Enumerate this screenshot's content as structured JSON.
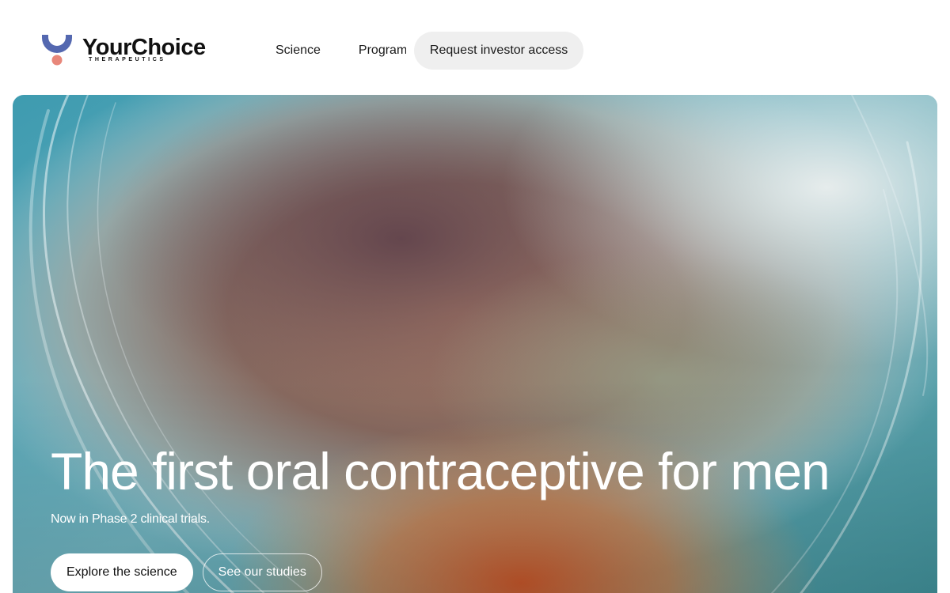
{
  "brand": {
    "name": "YourChoice",
    "tagline": "THERAPEUTICS",
    "colors": {
      "arc": "#5468b0",
      "dot": "#e8877a"
    }
  },
  "nav": {
    "links": [
      {
        "label": "Science"
      },
      {
        "label": "Programs"
      }
    ],
    "cta_label": "Request investor access"
  },
  "hero": {
    "title": "The first oral contraceptive for men",
    "subtitle": "Now in Phase 2 clinical trials.",
    "primary_label": "Explore the science",
    "secondary_label": "See our studies"
  }
}
